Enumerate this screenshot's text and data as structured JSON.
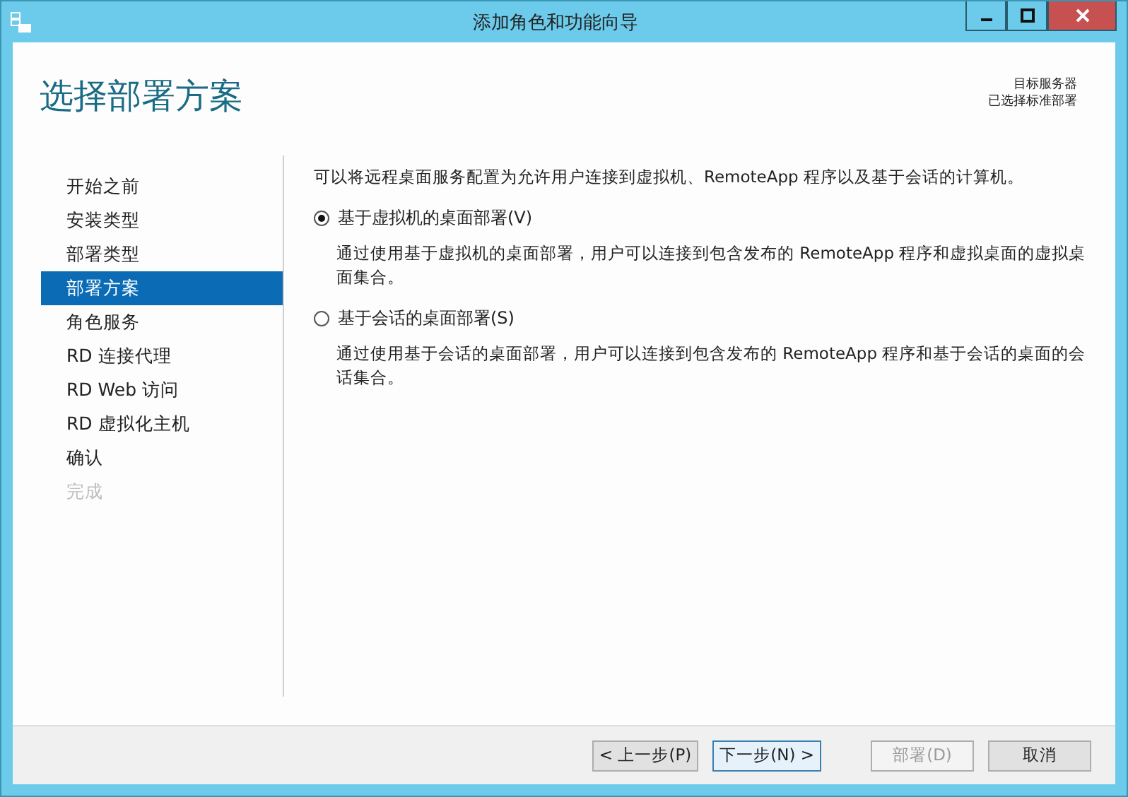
{
  "window": {
    "title": "添加角色和功能向导"
  },
  "page_title": "选择部署方案",
  "target_server": {
    "label": "目标服务器",
    "value": "已选择标准部署"
  },
  "steps": [
    {
      "label": "开始之前",
      "selected": false,
      "disabled": false
    },
    {
      "label": "安装类型",
      "selected": false,
      "disabled": false
    },
    {
      "label": "部署类型",
      "selected": false,
      "disabled": false
    },
    {
      "label": "部署方案",
      "selected": true,
      "disabled": false
    },
    {
      "label": "角色服务",
      "selected": false,
      "disabled": false
    },
    {
      "label": "RD 连接代理",
      "selected": false,
      "disabled": false
    },
    {
      "label": "RD Web 访问",
      "selected": false,
      "disabled": false
    },
    {
      "label": "RD 虚拟化主机",
      "selected": false,
      "disabled": false
    },
    {
      "label": "确认",
      "selected": false,
      "disabled": false
    },
    {
      "label": "完成",
      "selected": false,
      "disabled": true
    }
  ],
  "intro": "可以将远程桌面服务配置为允许用户连接到虚拟机、RemoteApp 程序以及基于会话的计算机。",
  "options": [
    {
      "label": "基于虚拟机的桌面部署(V)",
      "selected": true,
      "description": "通过使用基于虚拟机的桌面部署，用户可以连接到包含发布的 RemoteApp 程序和虚拟桌面的虚拟桌面集合。"
    },
    {
      "label": "基于会话的桌面部署(S)",
      "selected": false,
      "description": "通过使用基于会话的桌面部署，用户可以连接到包含发布的 RemoteApp 程序和基于会话的桌面的会话集合。"
    }
  ],
  "buttons": [
    {
      "label": "< 上一步(P)",
      "disabled": false,
      "focused": false
    },
    {
      "label": "下一步(N) >",
      "disabled": false,
      "focused": true
    },
    {
      "label": "部署(D)",
      "disabled": true,
      "focused": false
    },
    {
      "label": "取消",
      "disabled": false,
      "focused": false
    }
  ]
}
